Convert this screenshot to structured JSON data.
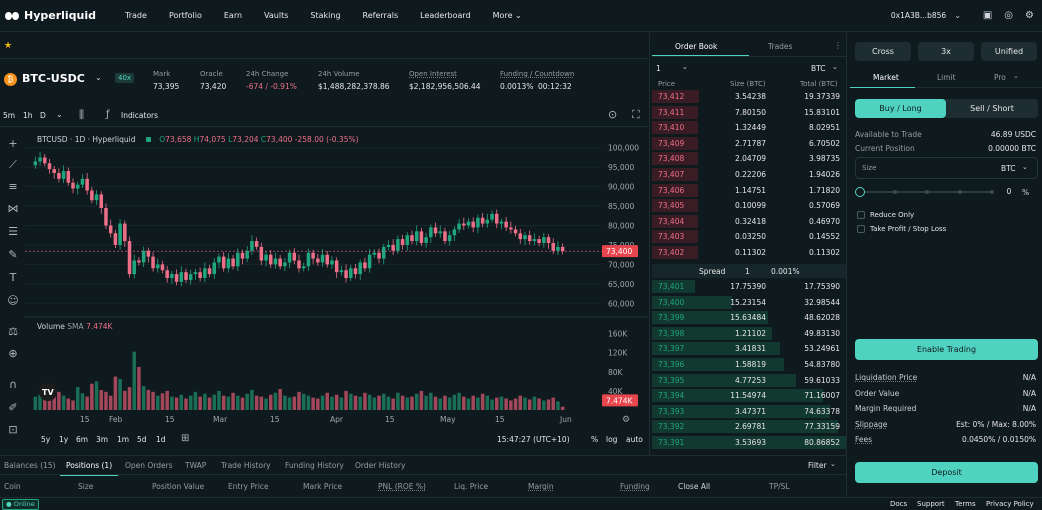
{
  "nav": {
    "brand": "Hyperliquid",
    "items": [
      "Trade",
      "Portfolio",
      "Earn",
      "Vaults",
      "Staking",
      "Referrals",
      "Leaderboard",
      "More"
    ],
    "wallet": "0x1A3B...b856"
  },
  "ticker": {
    "symbol": "BTC-USDC",
    "leverage": "40x"
  },
  "stats": [
    {
      "label": "Mark",
      "value": "73,395"
    },
    {
      "label": "Oracle",
      "value": "73,420"
    },
    {
      "label": "24h Change",
      "value": "-674 / -0.91%"
    },
    {
      "label": "24h Volume",
      "value": "$1,488,282,378.86"
    },
    {
      "label": "Open Interest",
      "value": "$2,182,956,506.44"
    },
    {
      "label": "Funding / Countdown",
      "value": "0.0013%",
      "value2": "00:12:32"
    }
  ],
  "chart": {
    "intervals": [
      "5m",
      "1h",
      "D"
    ],
    "indicators_label": "Indicators",
    "legend_title": "BTCUSD · 1D · Hyperliquid",
    "ohlc": {
      "o_label": "O",
      "o": "73,658",
      "h_label": "H",
      "h": "74,075",
      "l_label": "L",
      "l": "73,204",
      "c_label": "C",
      "c": "73,400",
      "chg": "-258.00 (-0.35%)"
    },
    "price_ticks": [
      "100,000",
      "95,000",
      "90,000",
      "85,000",
      "80,000",
      "75,000",
      "70,000",
      "65,000",
      "60,000"
    ],
    "last_price": "73,400",
    "volume_label": "Volume",
    "volume_sma": "SMA",
    "volume_value": "7.474K",
    "volume_ticks": [
      "160K",
      "120K",
      "80K",
      "40K"
    ],
    "volume_last": "7.474K",
    "x_ticks": [
      "15",
      "Feb",
      "15",
      "Mar",
      "15",
      "Apr",
      "15",
      "May",
      "15",
      "Jun"
    ],
    "ranges": [
      "5y",
      "1y",
      "6m",
      "3m",
      "1m",
      "5d",
      "1d"
    ],
    "time": "15:47:27 (UTC+10)",
    "scale_opts": [
      "%",
      "log",
      "auto"
    ]
  },
  "chart_data": {
    "type": "candlestick",
    "y_range": [
      57500,
      102500
    ],
    "candles_close": [
      96500,
      97500,
      96000,
      94500,
      93500,
      92000,
      94000,
      91000,
      89500,
      90500,
      92000,
      89000,
      86500,
      88000,
      84500,
      80000,
      78000,
      75000,
      80500,
      76000,
      67500,
      71000,
      70500,
      73500,
      72000,
      69000,
      70000,
      68500,
      66500,
      67500,
      65500,
      68000,
      66000,
      67500,
      68000,
      66500,
      69000,
      67500,
      70500,
      72000,
      69000,
      71500,
      69500,
      73000,
      71500,
      73500,
      76000,
      74500,
      71000,
      72500,
      70000,
      71500,
      69500,
      70500,
      73000,
      71000,
      69000,
      69500,
      73000,
      71500,
      70500,
      72500,
      70000,
      71000,
      68000,
      68500,
      66500,
      69000,
      67500,
      70500,
      69000,
      72500,
      73000,
      71500,
      74500,
      75000,
      73500,
      76500,
      75000,
      77500,
      76000,
      78500,
      75500,
      77000,
      79500,
      78000,
      78500,
      76000,
      77500,
      79000,
      80500,
      80000,
      81000,
      79500,
      82000,
      80500,
      81500,
      83000,
      80500,
      81000,
      79500,
      79000,
      78000,
      76500,
      77500,
      76000,
      76500,
      75500,
      77000,
      75500,
      73500,
      74500,
      73400
    ],
    "volume_k": [
      28,
      32,
      22,
      26,
      45,
      38,
      30,
      24,
      20,
      48,
      35,
      28,
      55,
      60,
      42,
      38,
      30,
      70,
      65,
      40,
      48,
      122,
      90,
      50,
      42,
      38,
      30,
      35,
      40,
      28,
      26,
      32,
      24,
      30,
      38,
      28,
      34,
      26,
      32,
      40,
      30,
      28,
      36,
      30,
      26,
      34,
      42,
      30,
      28,
      24,
      32,
      36,
      44,
      30,
      26,
      28,
      38,
      34,
      30,
      26,
      24,
      30,
      36,
      28,
      32,
      26,
      40,
      34,
      30,
      28,
      36,
      32,
      26,
      30,
      34,
      28,
      24,
      36,
      30,
      26,
      28,
      34,
      40,
      30,
      36,
      28,
      24,
      30,
      26,
      32,
      36,
      28,
      24,
      30,
      26,
      34,
      30,
      22,
      26,
      28,
      24,
      20,
      24,
      30,
      26,
      22,
      28,
      24,
      20,
      22,
      26,
      18,
      7
    ]
  },
  "orderbook": {
    "tabs": [
      "Order Book",
      "Trades"
    ],
    "grouping": "1",
    "unit": "BTC",
    "headers": [
      "Price",
      "Size (BTC)",
      "Total (BTC)"
    ],
    "asks": [
      [
        "73,412",
        "3.54238",
        "19.37339"
      ],
      [
        "73,411",
        "7.80150",
        "15.83101"
      ],
      [
        "73,410",
        "1.32449",
        "8.02951"
      ],
      [
        "73,409",
        "2.71787",
        "6.70502"
      ],
      [
        "73,408",
        "2.04709",
        "3.98735"
      ],
      [
        "73,407",
        "0.22206",
        "1.94026"
      ],
      [
        "73,406",
        "1.14751",
        "1.71820"
      ],
      [
        "73,405",
        "0.10099",
        "0.57069"
      ],
      [
        "73,404",
        "0.32418",
        "0.46970"
      ],
      [
        "73,403",
        "0.03250",
        "0.14552"
      ],
      [
        "73,402",
        "0.11302",
        "0.11302"
      ]
    ],
    "spread_label": "Spread",
    "spread_value": "1",
    "spread_pct": "0.001%",
    "bids": [
      [
        "73,401",
        "17.75390",
        "17.75390"
      ],
      [
        "73,400",
        "15.23154",
        "32.98544"
      ],
      [
        "73,399",
        "15.63484",
        "48.62028"
      ],
      [
        "73,398",
        "1.21102",
        "49.83130"
      ],
      [
        "73,397",
        "3.41831",
        "53.24961"
      ],
      [
        "73,396",
        "1.58819",
        "54.83780"
      ],
      [
        "73,395",
        "4.77253",
        "59.61033"
      ],
      [
        "73,394",
        "11.54974",
        "71.16007"
      ],
      [
        "73,393",
        "3.47371",
        "74.63378"
      ],
      [
        "73,392",
        "2.69781",
        "77.33159"
      ],
      [
        "73,391",
        "3.53693",
        "80.86852"
      ]
    ],
    "ask_depth": [
      0.24,
      0.2,
      0.1,
      0.08,
      0.05,
      0.02,
      0.02,
      0.01,
      0.01,
      0.005,
      0.003
    ],
    "bid_depth": [
      0.22,
      0.41,
      0.6,
      0.62,
      0.66,
      0.68,
      0.74,
      0.88,
      0.92,
      0.96,
      1.0
    ]
  },
  "order": {
    "margin_mode": "Cross",
    "leverage": "3x",
    "position_mode": "Unified",
    "types": [
      "Market",
      "Limit",
      "Pro"
    ],
    "buy": "Buy / Long",
    "sell": "Sell / Short",
    "avail_label": "Available to Trade",
    "avail_value": "46.89 USDC",
    "pos_label": "Current Position",
    "pos_value": "0.00000 BTC",
    "size_label": "Size",
    "size_unit": "BTC",
    "slider_value": "0",
    "slider_unit": "%",
    "reduce_only": "Reduce Only",
    "tpsl": "Take Profit / Stop Loss",
    "enable": "Enable Trading",
    "info": [
      [
        "Liquidation Price",
        "N/A"
      ],
      [
        "Order Value",
        "N/A"
      ],
      [
        "Margin Required",
        "N/A"
      ],
      [
        "Slippage",
        "Est: 0% / Max: 8.00%"
      ],
      [
        "Fees",
        "0.0450% / 0.0150%"
      ]
    ],
    "deposit": "Deposit"
  },
  "bottom": {
    "tabs": [
      "Balances (15)",
      "Positions (1)",
      "Open Orders",
      "TWAP",
      "Trade History",
      "Funding History",
      "Order History"
    ],
    "filter": "Filter",
    "columns": [
      "Coin",
      "Size",
      "Position Value",
      "Entry Price",
      "Mark Price",
      "PNL (ROE %)",
      "Liq. Price",
      "Margin",
      "Funding",
      "Close All",
      "TP/SL"
    ]
  },
  "footer": {
    "status": "Online",
    "links": [
      "Docs",
      "Support",
      "Terms",
      "Privacy Policy"
    ]
  },
  "colors": {
    "up": "#1fa67d",
    "down": "#ed7088",
    "accent": "#50d2c1",
    "bg": "#0f1a1f"
  }
}
